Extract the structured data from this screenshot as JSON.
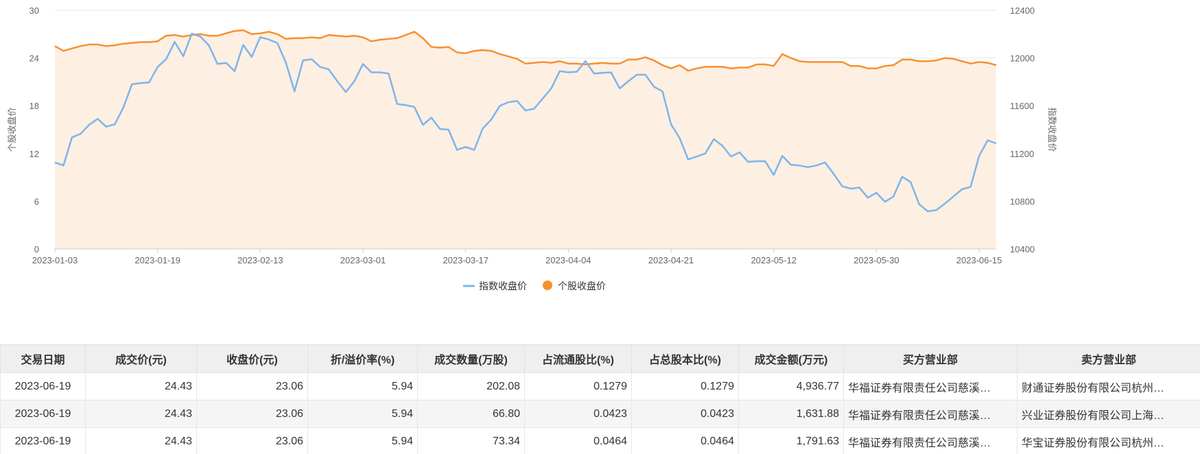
{
  "chart_data": {
    "type": "line",
    "y_left_label": "个股收盘价",
    "y_right_label": "指数收盘价",
    "ylim_left": [
      0,
      30
    ],
    "ylim_right": [
      10400,
      12400
    ],
    "y_left_ticks": [
      "0",
      "6",
      "12",
      "18",
      "24",
      "30"
    ],
    "y_right_ticks": [
      "10400",
      "10800",
      "11200",
      "11600",
      "12000",
      "12400"
    ],
    "x_tick_labels": [
      "2023-01-03",
      "2023-01-19",
      "2023-02-13",
      "2023-03-01",
      "2023-03-17",
      "2023-04-04",
      "2023-04-21",
      "2023-05-12",
      "2023-05-30",
      "2023-06-15"
    ],
    "x_tick_indices": [
      0,
      12,
      24,
      36,
      48,
      60,
      72,
      84,
      96,
      108
    ],
    "grid": "horizontal",
    "legend_position": "bottom-center",
    "series": [
      {
        "name": "指数收盘价",
        "axis": "right",
        "color": "#7cb5ec",
        "values": [
          11125,
          11100,
          11335,
          11365,
          11440,
          11490,
          11425,
          11445,
          11585,
          11780,
          11790,
          11795,
          11925,
          11990,
          12135,
          12015,
          12205,
          12180,
          12105,
          11950,
          11960,
          11890,
          12110,
          12010,
          12175,
          12155,
          12125,
          11960,
          11720,
          11980,
          11990,
          11925,
          11905,
          11805,
          11715,
          11805,
          11950,
          11880,
          11880,
          11870,
          11615,
          11605,
          11590,
          11440,
          11500,
          11405,
          11400,
          11230,
          11255,
          11230,
          11410,
          11485,
          11600,
          11630,
          11640,
          11560,
          11575,
          11660,
          11745,
          11890,
          11880,
          11885,
          11975,
          11870,
          11875,
          11880,
          11745,
          11805,
          11860,
          11860,
          11760,
          11720,
          11445,
          11330,
          11150,
          11175,
          11200,
          11320,
          11265,
          11175,
          11210,
          11130,
          11135,
          11135,
          11020,
          11180,
          11105,
          11100,
          11085,
          11100,
          11125,
          11030,
          10925,
          10905,
          10915,
          10830,
          10870,
          10795,
          10840,
          11005,
          10960,
          10775,
          10715,
          10725,
          10780,
          10840,
          10900,
          10920,
          11180,
          11310,
          11285
        ]
      },
      {
        "name": "个股收盘价",
        "axis": "left",
        "color": "#f7902f",
        "values": [
          25.5,
          24.9,
          25.2,
          25.5,
          25.7,
          25.7,
          25.5,
          25.6,
          25.8,
          25.9,
          26.0,
          26.0,
          26.1,
          26.8,
          26.9,
          26.7,
          26.9,
          27.0,
          26.8,
          26.8,
          27.1,
          27.4,
          27.5,
          27.0,
          27.1,
          27.3,
          27.0,
          26.4,
          26.5,
          26.5,
          26.6,
          26.5,
          26.9,
          26.8,
          26.7,
          26.8,
          26.6,
          26.1,
          26.3,
          26.4,
          26.5,
          26.9,
          27.3,
          26.5,
          25.4,
          25.3,
          25.4,
          24.7,
          24.6,
          24.9,
          25.0,
          24.9,
          24.5,
          24.2,
          23.9,
          23.3,
          23.4,
          23.5,
          23.4,
          23.6,
          23.3,
          23.3,
          23.2,
          23.3,
          23.4,
          23.3,
          23.3,
          23.8,
          23.8,
          24.1,
          23.7,
          23.1,
          22.7,
          23.1,
          22.4,
          22.7,
          22.9,
          22.9,
          22.9,
          22.7,
          22.8,
          22.8,
          23.2,
          23.2,
          23.0,
          24.5,
          24.0,
          23.6,
          23.5,
          23.5,
          23.5,
          23.5,
          23.5,
          23.0,
          23.0,
          22.7,
          22.7,
          23.0,
          23.1,
          23.8,
          23.8,
          23.6,
          23.6,
          23.7,
          24.0,
          23.9,
          23.6,
          23.3,
          23.5,
          23.4,
          23.1
        ]
      }
    ]
  },
  "legend": {
    "index_label": "指数收盘价",
    "stock_label": "个股收盘价"
  },
  "table": {
    "headers": [
      "交易日期",
      "成交价(元)",
      "收盘价(元)",
      "折/溢价率(%)",
      "成交数量(万股)",
      "占流通股比(%)",
      "占总股本比(%)",
      "成交金额(万元)",
      "买方营业部",
      "卖方营业部"
    ],
    "rows": [
      [
        "2023-06-19",
        "24.43",
        "23.06",
        "5.94",
        "202.08",
        "0.1279",
        "0.1279",
        "4,936.77",
        "华福证券有限责任公司慈溪…",
        "财通证券股份有限公司杭州…"
      ],
      [
        "2023-06-19",
        "24.43",
        "23.06",
        "5.94",
        "66.80",
        "0.0423",
        "0.0423",
        "1,631.88",
        "华福证券有限责任公司慈溪…",
        "兴业证券股份有限公司上海…"
      ],
      [
        "2023-06-19",
        "24.43",
        "23.06",
        "5.94",
        "73.34",
        "0.0464",
        "0.0464",
        "1,791.63",
        "华福证券有限责任公司慈溪…",
        "华宝证券股份有限公司杭州…"
      ]
    ]
  }
}
